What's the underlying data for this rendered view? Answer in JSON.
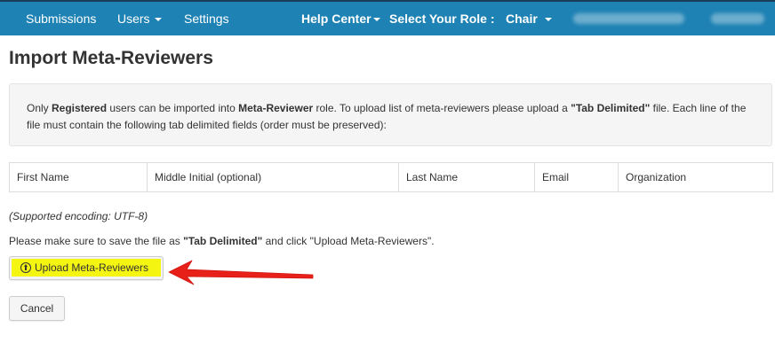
{
  "nav": {
    "submissions": "Submissions",
    "users": "Users",
    "settings": "Settings",
    "help_center": "Help Center",
    "select_role": "Select Your Role :",
    "role": "Chair"
  },
  "page_title": "Import Meta-Reviewers",
  "info": {
    "p1": "Only ",
    "b1": "Registered",
    "p2": " users can be imported into ",
    "b2": "Meta-Reviewer",
    "p3": " role. To upload list of meta-reviewers please upload a ",
    "b3": "\"Tab Delimited\"",
    "p4": " file. Each line of the file must contain the following tab delimited fields (order must be preserved):"
  },
  "fields": [
    "First Name",
    "Middle Initial (optional)",
    "Last Name",
    "Email",
    "Organization"
  ],
  "encoding_note": "(Supported encoding: UTF-8)",
  "instruction": {
    "p1": "Please make sure to save the file as ",
    "b1": "\"Tab Delimited\"",
    "p2": " and click \"Upload Meta-Reviewers\"."
  },
  "upload_label": "Upload Meta-Reviewers",
  "cancel_label": "Cancel",
  "colors": {
    "nav_bg": "#1e82b4",
    "highlight": "#f5f512",
    "arrow": "#e8201a"
  },
  "icons": [
    "caret-down-icon",
    "upload-circle-icon",
    "red-arrow-annotation"
  ]
}
